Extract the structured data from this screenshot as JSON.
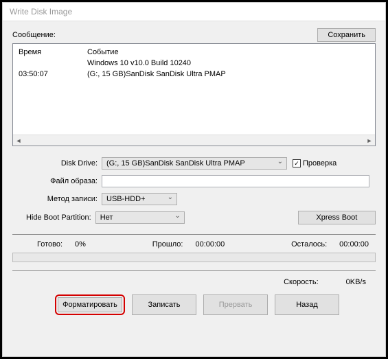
{
  "window": {
    "title": "Write Disk Image"
  },
  "message": {
    "label": "Сообщение:",
    "save_btn": "Сохранить"
  },
  "log": {
    "header_time": "Время",
    "header_event": "Событие",
    "rows": [
      {
        "time": "",
        "event": "Windows 10 v10.0 Build 10240"
      },
      {
        "time": "03:50:07",
        "event": "(G:, 15 GB)SanDisk SanDisk Ultra   PMAP"
      }
    ]
  },
  "form": {
    "drive_label": "Disk Drive:",
    "drive_value": "(G:, 15 GB)SanDisk SanDisk Ultra  PMAP",
    "verify_label": "Проверка",
    "verify_checked": "✓",
    "image_label": "Файл образа:",
    "image_value": "",
    "method_label": "Метод записи:",
    "method_value": "USB-HDD+",
    "hide_label": "Hide Boot Partition:",
    "hide_value": "Нет",
    "xpress_btn": "Xpress Boot"
  },
  "progress": {
    "done_label": "Готово:",
    "done_value": "0%",
    "elapsed_label": "Прошло:",
    "elapsed_value": "00:00:00",
    "remain_label": "Осталось:",
    "remain_value": "00:00:00",
    "speed_label": "Скорость:",
    "speed_value": "0KB/s"
  },
  "buttons": {
    "format": "Форматировать",
    "write": "Записать",
    "abort": "Прервать",
    "back": "Назад"
  }
}
